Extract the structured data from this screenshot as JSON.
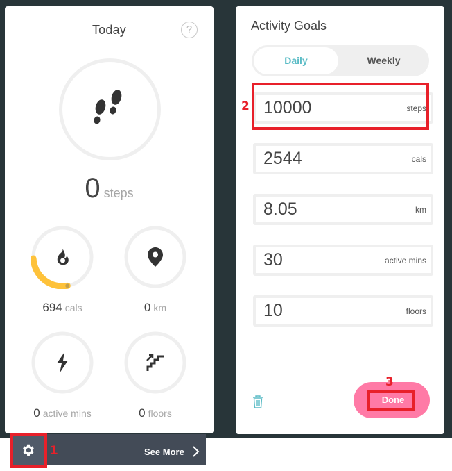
{
  "today": {
    "title": "Today",
    "help_icon": "question-circle-icon",
    "steps": {
      "value": "0",
      "unit": "steps",
      "icon": "footprints-icon"
    },
    "metrics": [
      {
        "key": "cals",
        "value": "694",
        "unit": "cals",
        "icon": "flame-icon",
        "progress": 0.27
      },
      {
        "key": "km",
        "value": "0",
        "unit": "km",
        "icon": "map-pin-icon",
        "progress": 0
      },
      {
        "key": "active",
        "value": "0",
        "unit": "active mins",
        "icon": "lightning-icon",
        "progress": 0
      },
      {
        "key": "floors",
        "value": "0",
        "unit": "floors",
        "icon": "stairs-icon",
        "progress": 0
      }
    ]
  },
  "bottom_bar": {
    "settings_icon": "gear-icon",
    "see_more_label": "See More",
    "chevron_icon": "chevron-right-icon"
  },
  "goals": {
    "title": "Activity Goals",
    "tabs": [
      {
        "label": "Daily",
        "active": true
      },
      {
        "label": "Weekly",
        "active": false
      }
    ],
    "fields": [
      {
        "value": "10000",
        "unit": "steps"
      },
      {
        "value": "2544",
        "unit": "cals"
      },
      {
        "value": "8.05",
        "unit": "km"
      },
      {
        "value": "30",
        "unit": "active mins"
      },
      {
        "value": "10",
        "unit": "floors"
      }
    ],
    "delete_icon": "trash-icon",
    "done_label": "Done"
  },
  "annotations": [
    {
      "number": "1",
      "target": "settings-button"
    },
    {
      "number": "2",
      "target": "steps-goal-field"
    },
    {
      "number": "3",
      "target": "done-button"
    }
  ],
  "colors": {
    "accent_teal": "#5bbcc6",
    "done_pink": "#ff7aa6",
    "progress_yellow": "#fec23a",
    "annotation_red": "#e8202a",
    "backdrop": "#283539",
    "bar": "#434b57"
  }
}
